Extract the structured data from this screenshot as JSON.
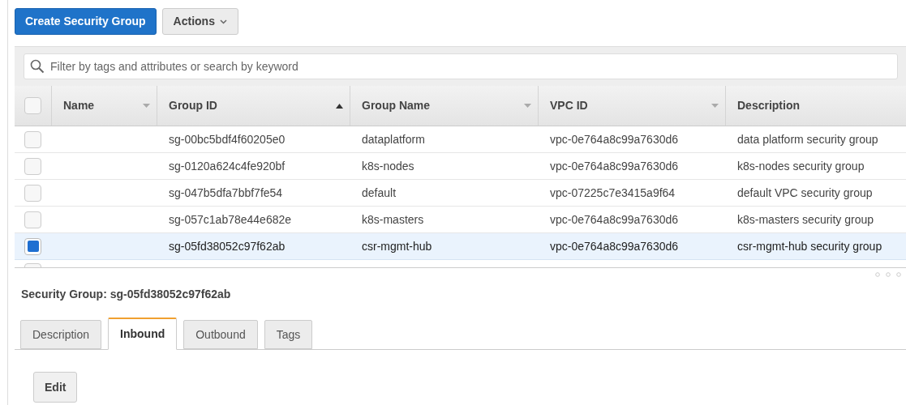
{
  "toolbar": {
    "create_button": "Create Security Group",
    "actions_button": "Actions"
  },
  "search": {
    "placeholder": "Filter by tags and attributes or search by keyword"
  },
  "table": {
    "header_checked": false,
    "columns": [
      {
        "label": "Name",
        "sorted": false
      },
      {
        "label": "Group ID",
        "sorted": true
      },
      {
        "label": "Group Name",
        "sorted": false
      },
      {
        "label": "VPC ID",
        "sorted": false
      },
      {
        "label": "Description"
      }
    ],
    "rows": [
      {
        "selected": false,
        "cells": [
          "",
          "sg-00bc5bdf4f60205e0",
          "dataplatform",
          "vpc-0e764a8c99a7630d6",
          "data platform security group"
        ]
      },
      {
        "selected": false,
        "cells": [
          "",
          "sg-0120a624c4fe920bf",
          "k8s-nodes",
          "vpc-0e764a8c99a7630d6",
          "k8s-nodes security group"
        ]
      },
      {
        "selected": false,
        "cells": [
          "",
          "sg-047b5dfa7bbf7fe54",
          "default",
          "vpc-07225c7e3415a9f64",
          "default VPC security group"
        ]
      },
      {
        "selected": false,
        "cells": [
          "",
          "sg-057c1ab78e44e682e",
          "k8s-masters",
          "vpc-0e764a8c99a7630d6",
          "k8s-masters security group"
        ]
      },
      {
        "selected": true,
        "cells": [
          "",
          "sg-05fd38052c97f62ab",
          "csr-mgmt-hub",
          "vpc-0e764a8c99a7630d6",
          "csr-mgmt-hub security group"
        ]
      }
    ],
    "partial_row": {
      "selected": false
    }
  },
  "details": {
    "title": "Security Group: sg-05fd38052c97f62ab",
    "tabs": [
      {
        "label": "Description",
        "selected": false
      },
      {
        "label": "Inbound",
        "selected": true
      },
      {
        "label": "Outbound",
        "selected": false
      },
      {
        "label": "Tags",
        "selected": false
      }
    ],
    "edit_button": "Edit"
  }
}
